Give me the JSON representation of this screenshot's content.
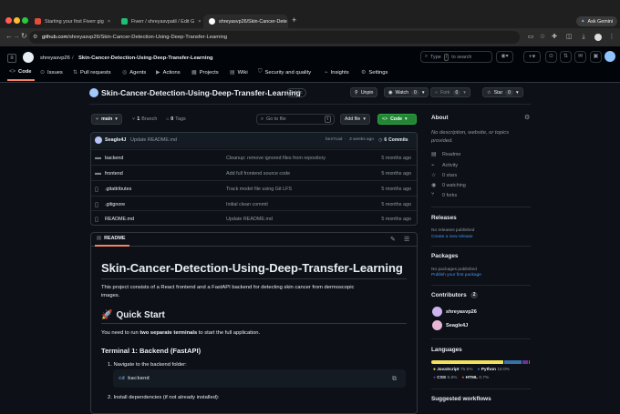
{
  "browser": {
    "tabs": [
      {
        "title": "Starting your first Fiverr gig",
        "fav": "#1dbf73"
      },
      {
        "title": "Fiverr / shreyasvpatil / Edit G",
        "fav": "#1dbf73"
      },
      {
        "title": "shreyasvp26/Skin-Cancer-Dete",
        "fav": "#ffffff"
      }
    ],
    "url_host": "github.com",
    "url_path": "/shreyasvp26/Skin-Cancer-Detection-Using-Deep-Transfer-Learning",
    "ask_gemini": "Ask Gemini"
  },
  "header": {
    "owner": "shreyasvp26",
    "repo": "Skin-Cancer-Detection-Using-Deep-Transfer-Learning",
    "search_placeholder": "Type / to search",
    "type_key": "/",
    "search_text": "to search"
  },
  "repo_nav": [
    {
      "label": "Code",
      "icon": "code-icon"
    },
    {
      "label": "Issues",
      "icon": "issue-icon"
    },
    {
      "label": "Pull requests",
      "icon": "pull-request-icon"
    },
    {
      "label": "Agents",
      "icon": "agent-icon"
    },
    {
      "label": "Actions",
      "icon": "play-icon"
    },
    {
      "label": "Projects",
      "icon": "table-icon"
    },
    {
      "label": "Wiki",
      "icon": "book-icon"
    },
    {
      "label": "Security and quality",
      "icon": "shield-icon"
    },
    {
      "label": "Insights",
      "icon": "graph-icon"
    },
    {
      "label": "Settings",
      "icon": "gear-icon"
    }
  ],
  "repo_title": {
    "name": "Skin-Cancer-Detection-Using-Deep-Transfer-Learning",
    "visibility": "Public"
  },
  "actions": {
    "unpin": "Unpin",
    "watch": "Watch",
    "watch_count": "0",
    "fork": "Fork",
    "fork_count": "0",
    "star": "Star",
    "star_count": "0"
  },
  "toolbar": {
    "branch": "main",
    "branch_count": "1",
    "branch_label": "Branch",
    "tag_count": "0",
    "tag_label": "Tags",
    "goto_placeholder": "Go to file",
    "goto_key": "t",
    "add_file": "Add file",
    "code": "Code"
  },
  "commit": {
    "author": "Seagle4J",
    "message": "Update README.md",
    "hash": "be27cad",
    "age": "3 weeks ago",
    "commits_count": "6",
    "commits_label": "Commits"
  },
  "files": [
    {
      "name": "backend",
      "type": "folder",
      "message": "Cleanup: remove ignored files from repository",
      "age": "5 months ago"
    },
    {
      "name": "frontend",
      "type": "folder",
      "message": "Add full frontend source code",
      "age": "5 months ago"
    },
    {
      "name": ".gitattributes",
      "type": "file",
      "message": "Track model file using Git LFS",
      "age": "5 months ago"
    },
    {
      "name": ".gitignore",
      "type": "file",
      "message": "Initial clean commit",
      "age": "5 months ago"
    },
    {
      "name": "README.md",
      "type": "file",
      "message": "Update README.md",
      "age": "5 months ago"
    }
  ],
  "readme": {
    "tab": "README",
    "title": "Skin-Cancer-Detection-Using-Deep-Transfer-Learning",
    "intro_line1": "This project consists of a React frontend and a FastAPI backend for detecting skin cancer from dermoscopic",
    "intro_line2": "images.",
    "quick_start": "Quick Start",
    "run_prefix": "You need to run ",
    "run_bold": "two separate terminals",
    "run_suffix": " to start the full application.",
    "terminal1": "Terminal 1: Backend (FastAPI)",
    "step1": "Navigate to the backend folder:",
    "code_cmd": "cd",
    "code_arg": "backend",
    "step2": "Install dependencies (if not already installed):"
  },
  "about": {
    "heading": "About",
    "desc_line1": "No description, website, or topics",
    "desc_line2": "provided.",
    "items": [
      "Readme",
      "Activity",
      "0 stars",
      "0 watching",
      "0 forks"
    ]
  },
  "releases": {
    "heading": "Releases",
    "text": "No releases published",
    "link": "Create a new release"
  },
  "packages": {
    "heading": "Packages",
    "text": "No packages published",
    "link": "Publish your first package"
  },
  "contributors": {
    "heading": "Contributors",
    "count": "2",
    "people": [
      "shreyasvp26",
      "Seagle4J"
    ]
  },
  "languages": {
    "heading": "Languages",
    "list": [
      {
        "name": "JavaScript",
        "pct": "75.5%",
        "value": 75.5,
        "color": "#f1e05a"
      },
      {
        "name": "Python",
        "pct": "18.0%",
        "value": 18.0,
        "color": "#3572A5"
      },
      {
        "name": "CSS",
        "pct": "5.8%",
        "value": 5.8,
        "color": "#663399"
      },
      {
        "name": "HTML",
        "pct": "0.7%",
        "value": 0.7,
        "color": "#e34c26"
      }
    ]
  },
  "suggested": "Suggested workflows"
}
